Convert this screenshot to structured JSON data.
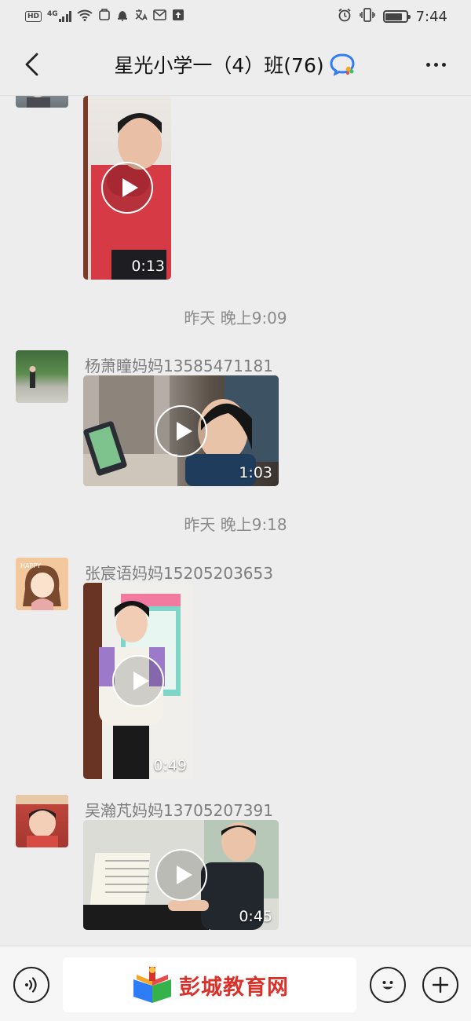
{
  "status_bar": {
    "network_badge": "HD",
    "network_type": "4G",
    "time": "7:44",
    "battery_level_percent": 85,
    "icons": [
      "hd-icon",
      "signal-icon",
      "wifi-icon",
      "nfc-icon",
      "notification-icon",
      "translate-icon",
      "mail-icon",
      "upload-icon",
      "alarm-icon",
      "vibrate-icon",
      "battery-icon"
    ]
  },
  "header": {
    "title": "星光小学一（4）班(76)",
    "back_icon": "chevron-left-icon",
    "badge_icon": "enterprise-chat-icon",
    "more_icon": "more-dots-icon"
  },
  "messages": [
    {
      "type": "video",
      "sender": "",
      "duration": "0:13"
    },
    {
      "type": "timestamp",
      "text": "昨天 晚上9:09"
    },
    {
      "type": "video",
      "sender": "杨萧瞳妈妈13585471181",
      "duration": "1:03"
    },
    {
      "type": "timestamp",
      "text": "昨天 晚上9:18"
    },
    {
      "type": "video",
      "sender": "张宸语妈妈15205203653",
      "duration": "0:49"
    },
    {
      "type": "video",
      "sender": "吴瀚芃妈妈13705207391",
      "duration": "0:45"
    }
  ],
  "input_bar": {
    "voice_icon": "voice-icon",
    "emoji_icon": "emoji-icon",
    "add_icon": "plus-icon",
    "watermark": "彭城教育网",
    "watermark_icon": "book-logo-icon"
  },
  "colors": {
    "background": "#ededed",
    "watermark_red": "#d8322a",
    "accent_blue": "#2e7cf6"
  }
}
